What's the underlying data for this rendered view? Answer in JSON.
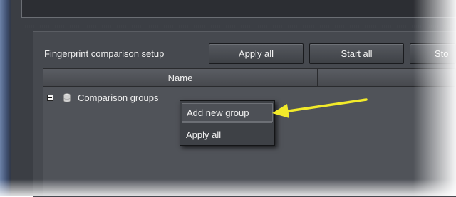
{
  "setup": {
    "label": "Fingerprint comparison setup",
    "buttons": {
      "apply_all": "Apply all",
      "start_all": "Start all",
      "stop_all_partial": "Sto"
    }
  },
  "table": {
    "columns": [
      "Name",
      ""
    ],
    "tree": {
      "expander": "minus",
      "icon": "database-icon",
      "label": "Comparison groups"
    }
  },
  "context_menu": {
    "items": [
      "Add new group",
      "Apply all"
    ],
    "highlighted_index": 0
  },
  "annotation": {
    "arrow_color": "#f2ea2a"
  }
}
